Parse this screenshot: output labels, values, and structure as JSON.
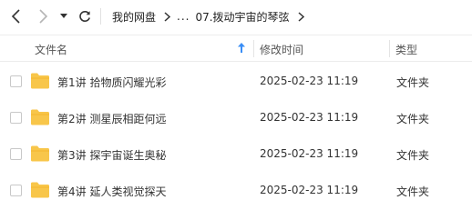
{
  "toolbar": {
    "back_icon": "chevron-left-icon",
    "forward_icon": "chevron-right-icon",
    "dropdown_icon": "caret-down-icon",
    "refresh_icon": "refresh-icon"
  },
  "breadcrumb": {
    "root": "我的网盘",
    "ellipsis": "...",
    "current": "07.拨动宇宙的琴弦"
  },
  "columns": {
    "name": "文件名",
    "modified": "修改时间",
    "type": "类型"
  },
  "files": [
    {
      "name": "第1讲 拾物质闪耀光彩",
      "modified": "2025-02-23 11:19",
      "type": "文件夹"
    },
    {
      "name": "第2讲 测星辰相距何远",
      "modified": "2025-02-23 11:19",
      "type": "文件夹"
    },
    {
      "name": "第3讲 探宇宙诞生奥秘",
      "modified": "2025-02-23 11:19",
      "type": "文件夹"
    },
    {
      "name": "第4讲 延人类视觉探天",
      "modified": "2025-02-23 11:19",
      "type": "文件夹"
    }
  ],
  "colors": {
    "folder": "#F8C64A",
    "sort_arrow": "#3A8EF6"
  }
}
